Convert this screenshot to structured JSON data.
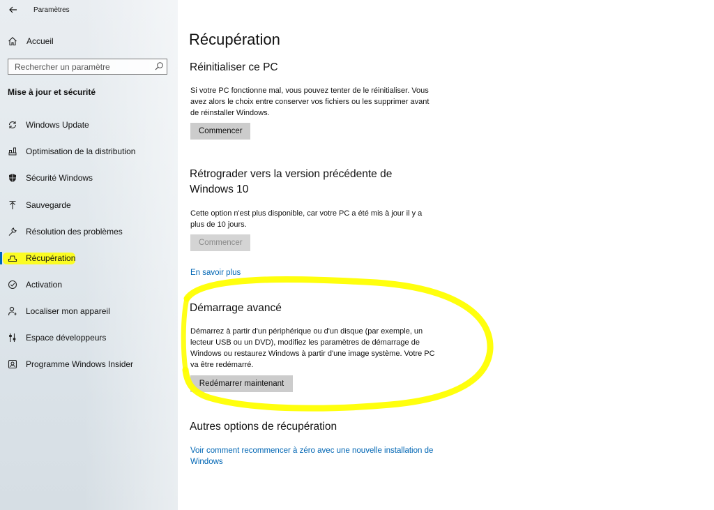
{
  "window": {
    "title": "Paramètres"
  },
  "sidebar": {
    "home_label": "Accueil",
    "search_placeholder": "Rechercher un paramètre",
    "section_title": "Mise à jour et sécurité",
    "items": [
      {
        "label": "Windows Update",
        "icon": "sync-icon"
      },
      {
        "label": "Optimisation de la distribution",
        "icon": "delivery-icon"
      },
      {
        "label": "Sécurité Windows",
        "icon": "shield-icon"
      },
      {
        "label": "Sauvegarde",
        "icon": "upload-icon"
      },
      {
        "label": "Résolution des problèmes",
        "icon": "wrench-icon"
      },
      {
        "label": "Récupération",
        "icon": "recovery-icon",
        "active": true
      },
      {
        "label": "Activation",
        "icon": "check-circle-icon"
      },
      {
        "label": "Localiser mon appareil",
        "icon": "person-pin-icon"
      },
      {
        "label": "Espace développeurs",
        "icon": "sliders-icon"
      },
      {
        "label": "Programme Windows Insider",
        "icon": "insider-icon"
      }
    ]
  },
  "main": {
    "title": "Récupération",
    "reset": {
      "heading": "Réinitialiser ce PC",
      "text": "Si votre PC fonctionne mal, vous pouvez tenter de le réinitialiser. Vous avez alors le choix entre conserver vos fichiers ou les supprimer avant de réinstaller Windows.",
      "button": "Commencer"
    },
    "rollback": {
      "heading": "Rétrograder vers la version précédente de Windows 10",
      "text": "Cette option n'est plus disponible, car votre PC a été mis à jour il y a plus de 10 jours.",
      "button": "Commencer",
      "link": "En savoir plus"
    },
    "advanced": {
      "heading": "Démarrage avancé",
      "text": "Démarrez à partir d'un périphérique ou d'un disque (par exemple, un lecteur USB ou un DVD), modifiez les paramètres de démarrage de Windows ou restaurez Windows à partir d'une image système. Votre PC va être redémarré.",
      "button": "Redémarrer maintenant"
    },
    "other": {
      "heading": "Autres options de récupération",
      "link": "Voir comment recommencer à zéro avec une nouvelle installation de Windows"
    }
  },
  "colors": {
    "accent": "#0067c0",
    "link": "#0066b4",
    "highlight": "#ffff00"
  }
}
